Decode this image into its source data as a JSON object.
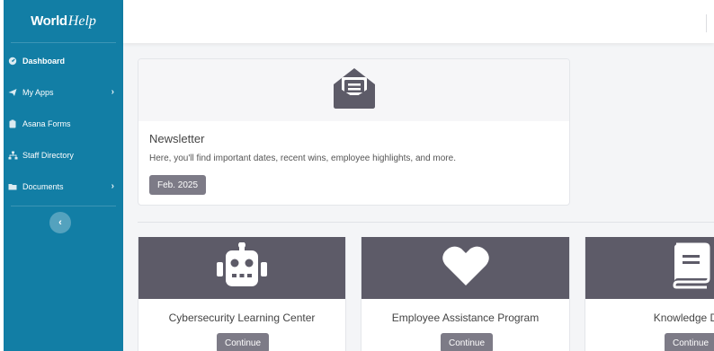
{
  "brand": {
    "bold": "World",
    "script": "Help"
  },
  "sidebar": {
    "items": [
      {
        "label": "Dashboard",
        "icon": "dashboard-icon",
        "active": true,
        "chevron": ""
      },
      {
        "label": "My Apps",
        "icon": "paper-plane-icon",
        "active": false,
        "chevron": "›"
      },
      {
        "label": "Asana Forms",
        "icon": "clipboard-icon",
        "active": false,
        "chevron": ""
      },
      {
        "label": "Staff Directory",
        "icon": "sitemap-icon",
        "active": false,
        "chevron": ""
      },
      {
        "label": "Documents",
        "icon": "folder-icon",
        "active": false,
        "chevron": "›"
      }
    ],
    "collapse_label": "‹"
  },
  "newsletter": {
    "icon": "envelope-open-icon",
    "title": "Newsletter",
    "description": "Here, you'll find important dates, recent wins, employee highlights, and more.",
    "button": "Feb. 2025"
  },
  "cards": [
    {
      "title": "Cybersecurity Learning Center",
      "icon": "robot-icon",
      "button": "Continue"
    },
    {
      "title": "Employee Assistance Program",
      "icon": "heart-icon",
      "button": "Continue"
    },
    {
      "title": "Knowledge Dat",
      "icon": "book-icon",
      "button": "Continue"
    }
  ],
  "colors": {
    "sidebar": "#127ea5",
    "card_header": "#5d5b68",
    "button": "#7d7b87",
    "page_bg": "#f4f5f7"
  }
}
